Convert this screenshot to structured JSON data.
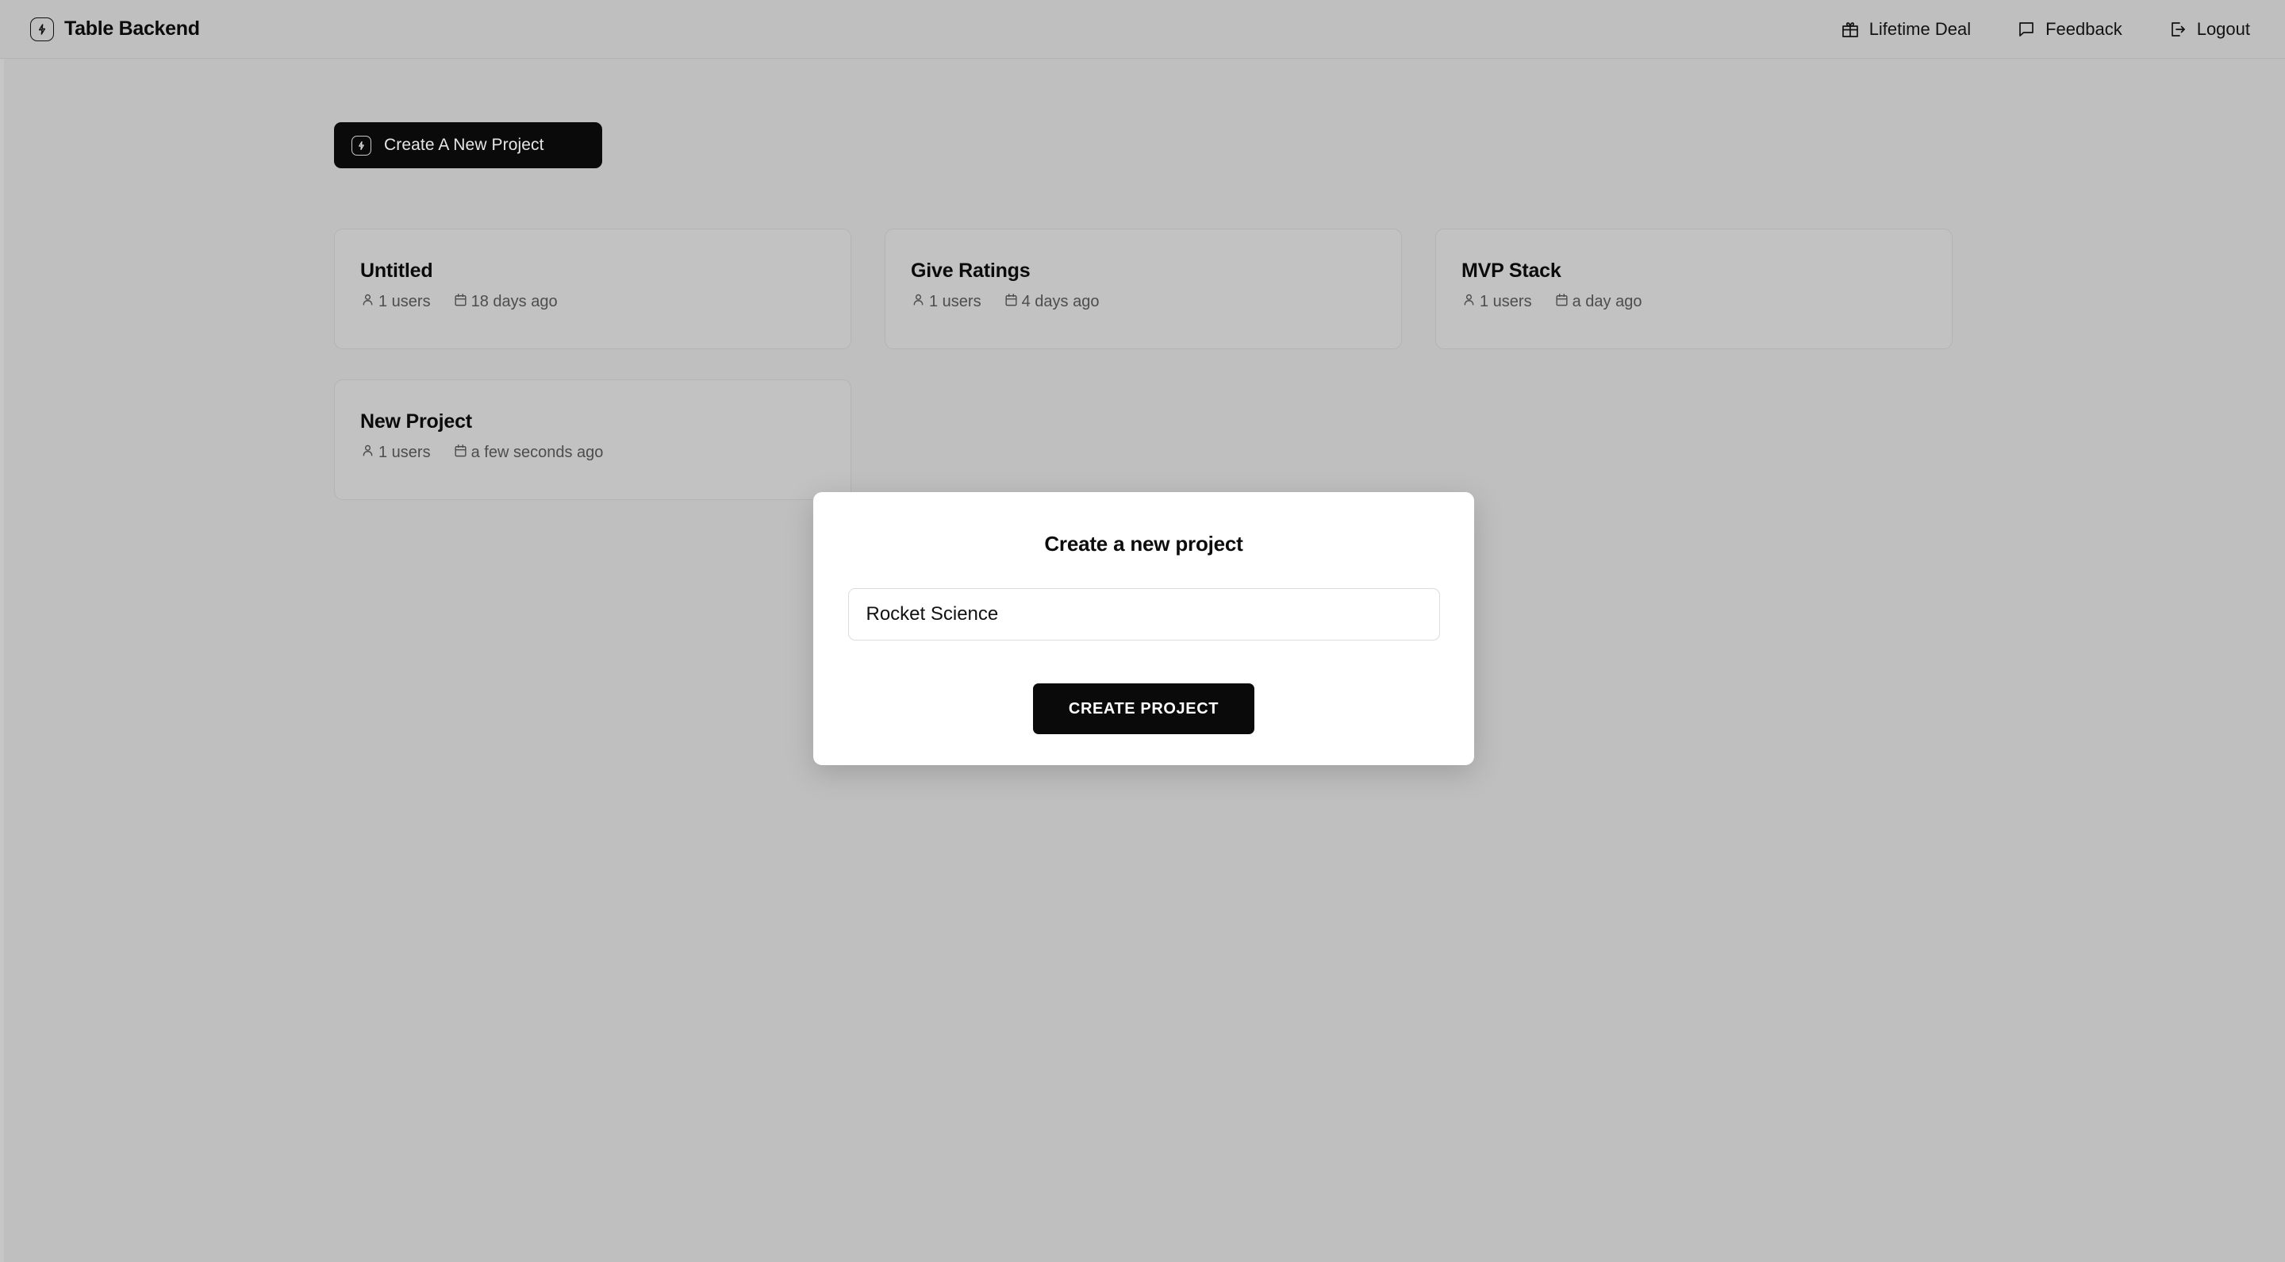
{
  "header": {
    "brand": "Table Backend",
    "logo_icon": "lightning-bolt-icon",
    "nav": [
      {
        "label": "Lifetime Deal",
        "icon": "gift-icon"
      },
      {
        "label": "Feedback",
        "icon": "chat-bubble-icon"
      },
      {
        "label": "Logout",
        "icon": "logout-icon"
      }
    ]
  },
  "toolbar": {
    "create_label": "Create A New Project",
    "create_icon": "lightning-bolt-icon"
  },
  "projects": [
    {
      "title": "Untitled",
      "users": "1 users",
      "updated": "18 days ago"
    },
    {
      "title": "Give Ratings",
      "users": "1 users",
      "updated": "4 days ago"
    },
    {
      "title": "MVP Stack",
      "users": "1 users",
      "updated": "a day ago"
    },
    {
      "title": "New Project",
      "users": "1 users",
      "updated": "a few seconds ago"
    }
  ],
  "meta_icons": {
    "users": "person-icon",
    "updated": "calendar-icon"
  },
  "modal": {
    "title": "Create a new project",
    "input_value": "Rocket Science",
    "input_placeholder": "",
    "submit_label": "CREATE PROJECT"
  },
  "colors": {
    "page_background": "#bfbfbf",
    "card_background": "#c2c2c2",
    "card_border": "#b4b4b4",
    "accent_black": "#0a0a0a",
    "modal_background": "#ffffff",
    "muted_text": "#4d4d4d"
  }
}
